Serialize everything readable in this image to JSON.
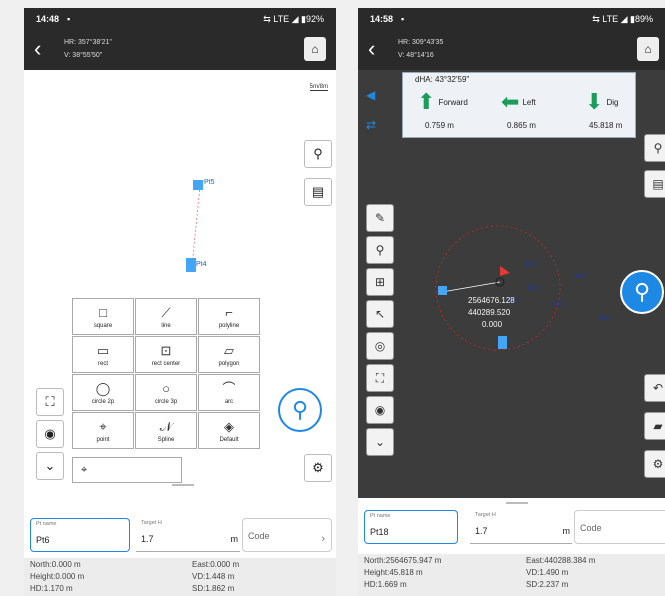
{
  "left": {
    "status": {
      "time": "14:48",
      "network": "LTE",
      "battery": "92%"
    },
    "header": {
      "hr": "HR: 357°38'21\"",
      "v": "V: 38°55'50\""
    },
    "scale": "5m/8m",
    "points": [
      {
        "label": "Pt5"
      },
      {
        "label": "Pt4"
      }
    ],
    "tools": [
      {
        "label": "square",
        "icon": "□"
      },
      {
        "label": "line",
        "icon": "⟋"
      },
      {
        "label": "polyline",
        "icon": "⌐"
      },
      {
        "label": "rect",
        "icon": "▭"
      },
      {
        "label": "rect center",
        "icon": "⊡"
      },
      {
        "label": "polygon",
        "icon": "▱"
      },
      {
        "label": "circle 2p",
        "icon": "◯"
      },
      {
        "label": "circle 3p",
        "icon": "○"
      },
      {
        "label": "arc",
        "icon": "⌒"
      },
      {
        "label": "point",
        "icon": "⌖"
      },
      {
        "label": "Spline",
        "icon": "𝒩"
      },
      {
        "label": "Default",
        "icon": "◈"
      }
    ],
    "form": {
      "pt_name_label": "Pt name",
      "pt_name_value": "Pt6",
      "target_h_label": "Target H",
      "target_h_value": "1.7",
      "unit": "m",
      "code_placeholder": "Code"
    },
    "info": {
      "north": "North:0.000 m",
      "east": "East:0.000 m",
      "height": "Height:0.000 m",
      "vd": "VD:1.448 m",
      "hd": "HD:1.170 m",
      "sd": "SD:1.862 m"
    }
  },
  "right": {
    "status": {
      "time": "14:58",
      "network": "LTE",
      "battery": "89%"
    },
    "header": {
      "hr": "HR: 309°43'35",
      "v": "V: 48°14'16"
    },
    "nav": {
      "dha": "dHA:  43°32'59\"",
      "forward_label": "Forward",
      "forward_value": "0.759 m",
      "left_label": "Left",
      "left_value": "0.865 m",
      "dig_label": "Dig",
      "dig_value": "45.818 m"
    },
    "coords": [
      "2564676.128",
      "440289.520",
      "0.000"
    ],
    "points": [
      {
        "label": "Pt18"
      },
      {
        "label": "Pt16"
      },
      {
        "label": "Pt15"
      },
      {
        "label": "Pt14"
      },
      {
        "label": "Pt13"
      },
      {
        "label": "Pt12"
      }
    ],
    "form": {
      "pt_name_label": "Pt name",
      "pt_name_value": "Pt18",
      "target_h_label": "Target H",
      "target_h_value": "1.7",
      "unit": "m",
      "code_placeholder": "Code"
    },
    "info": {
      "north": "North:2564675.947 m",
      "east": "East:440288.384 m",
      "height": "Height:45.818 m",
      "vd": "VD:1.490 m",
      "hd": "HD:1.669 m",
      "sd": "SD:2.237 m"
    }
  },
  "colors": {
    "accent": "#1e88e5",
    "arrow": "#1a9d5a",
    "dark": "#2a2a2a"
  }
}
